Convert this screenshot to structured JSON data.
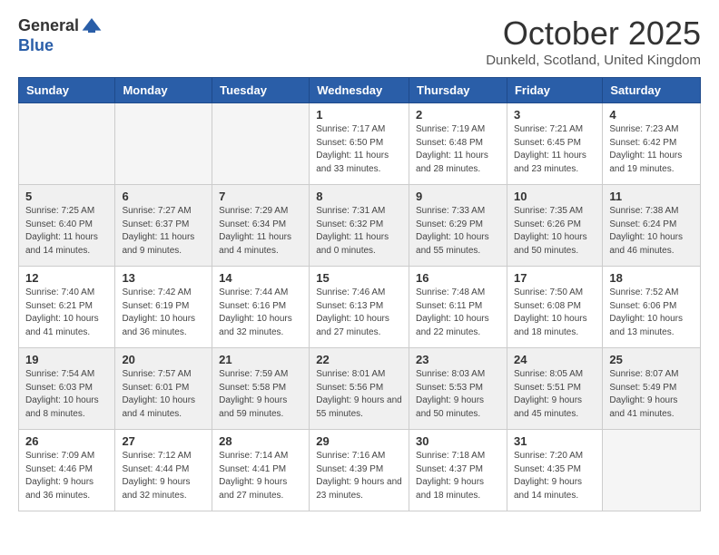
{
  "header": {
    "logo_general": "General",
    "logo_blue": "Blue",
    "month_title": "October 2025",
    "subtitle": "Dunkeld, Scotland, United Kingdom"
  },
  "days_of_week": [
    "Sunday",
    "Monday",
    "Tuesday",
    "Wednesday",
    "Thursday",
    "Friday",
    "Saturday"
  ],
  "weeks": [
    [
      {
        "day": "",
        "info": "",
        "empty": true
      },
      {
        "day": "",
        "info": "",
        "empty": true
      },
      {
        "day": "",
        "info": "",
        "empty": true
      },
      {
        "day": "1",
        "info": "Sunrise: 7:17 AM\nSunset: 6:50 PM\nDaylight: 11 hours\nand 33 minutes."
      },
      {
        "day": "2",
        "info": "Sunrise: 7:19 AM\nSunset: 6:48 PM\nDaylight: 11 hours\nand 28 minutes."
      },
      {
        "day": "3",
        "info": "Sunrise: 7:21 AM\nSunset: 6:45 PM\nDaylight: 11 hours\nand 23 minutes."
      },
      {
        "day": "4",
        "info": "Sunrise: 7:23 AM\nSunset: 6:42 PM\nDaylight: 11 hours\nand 19 minutes."
      }
    ],
    [
      {
        "day": "5",
        "info": "Sunrise: 7:25 AM\nSunset: 6:40 PM\nDaylight: 11 hours\nand 14 minutes.",
        "shaded": true
      },
      {
        "day": "6",
        "info": "Sunrise: 7:27 AM\nSunset: 6:37 PM\nDaylight: 11 hours\nand 9 minutes.",
        "shaded": true
      },
      {
        "day": "7",
        "info": "Sunrise: 7:29 AM\nSunset: 6:34 PM\nDaylight: 11 hours\nand 4 minutes.",
        "shaded": true
      },
      {
        "day": "8",
        "info": "Sunrise: 7:31 AM\nSunset: 6:32 PM\nDaylight: 11 hours\nand 0 minutes.",
        "shaded": true
      },
      {
        "day": "9",
        "info": "Sunrise: 7:33 AM\nSunset: 6:29 PM\nDaylight: 10 hours\nand 55 minutes.",
        "shaded": true
      },
      {
        "day": "10",
        "info": "Sunrise: 7:35 AM\nSunset: 6:26 PM\nDaylight: 10 hours\nand 50 minutes.",
        "shaded": true
      },
      {
        "day": "11",
        "info": "Sunrise: 7:38 AM\nSunset: 6:24 PM\nDaylight: 10 hours\nand 46 minutes.",
        "shaded": true
      }
    ],
    [
      {
        "day": "12",
        "info": "Sunrise: 7:40 AM\nSunset: 6:21 PM\nDaylight: 10 hours\nand 41 minutes."
      },
      {
        "day": "13",
        "info": "Sunrise: 7:42 AM\nSunset: 6:19 PM\nDaylight: 10 hours\nand 36 minutes."
      },
      {
        "day": "14",
        "info": "Sunrise: 7:44 AM\nSunset: 6:16 PM\nDaylight: 10 hours\nand 32 minutes."
      },
      {
        "day": "15",
        "info": "Sunrise: 7:46 AM\nSunset: 6:13 PM\nDaylight: 10 hours\nand 27 minutes."
      },
      {
        "day": "16",
        "info": "Sunrise: 7:48 AM\nSunset: 6:11 PM\nDaylight: 10 hours\nand 22 minutes."
      },
      {
        "day": "17",
        "info": "Sunrise: 7:50 AM\nSunset: 6:08 PM\nDaylight: 10 hours\nand 18 minutes."
      },
      {
        "day": "18",
        "info": "Sunrise: 7:52 AM\nSunset: 6:06 PM\nDaylight: 10 hours\nand 13 minutes."
      }
    ],
    [
      {
        "day": "19",
        "info": "Sunrise: 7:54 AM\nSunset: 6:03 PM\nDaylight: 10 hours\nand 8 minutes.",
        "shaded": true
      },
      {
        "day": "20",
        "info": "Sunrise: 7:57 AM\nSunset: 6:01 PM\nDaylight: 10 hours\nand 4 minutes.",
        "shaded": true
      },
      {
        "day": "21",
        "info": "Sunrise: 7:59 AM\nSunset: 5:58 PM\nDaylight: 9 hours\nand 59 minutes.",
        "shaded": true
      },
      {
        "day": "22",
        "info": "Sunrise: 8:01 AM\nSunset: 5:56 PM\nDaylight: 9 hours\nand 55 minutes.",
        "shaded": true
      },
      {
        "day": "23",
        "info": "Sunrise: 8:03 AM\nSunset: 5:53 PM\nDaylight: 9 hours\nand 50 minutes.",
        "shaded": true
      },
      {
        "day": "24",
        "info": "Sunrise: 8:05 AM\nSunset: 5:51 PM\nDaylight: 9 hours\nand 45 minutes.",
        "shaded": true
      },
      {
        "day": "25",
        "info": "Sunrise: 8:07 AM\nSunset: 5:49 PM\nDaylight: 9 hours\nand 41 minutes.",
        "shaded": true
      }
    ],
    [
      {
        "day": "26",
        "info": "Sunrise: 7:09 AM\nSunset: 4:46 PM\nDaylight: 9 hours\nand 36 minutes."
      },
      {
        "day": "27",
        "info": "Sunrise: 7:12 AM\nSunset: 4:44 PM\nDaylight: 9 hours\nand 32 minutes."
      },
      {
        "day": "28",
        "info": "Sunrise: 7:14 AM\nSunset: 4:41 PM\nDaylight: 9 hours\nand 27 minutes."
      },
      {
        "day": "29",
        "info": "Sunrise: 7:16 AM\nSunset: 4:39 PM\nDaylight: 9 hours\nand 23 minutes."
      },
      {
        "day": "30",
        "info": "Sunrise: 7:18 AM\nSunset: 4:37 PM\nDaylight: 9 hours\nand 18 minutes."
      },
      {
        "day": "31",
        "info": "Sunrise: 7:20 AM\nSunset: 4:35 PM\nDaylight: 9 hours\nand 14 minutes."
      },
      {
        "day": "",
        "info": "",
        "empty": true
      }
    ]
  ]
}
